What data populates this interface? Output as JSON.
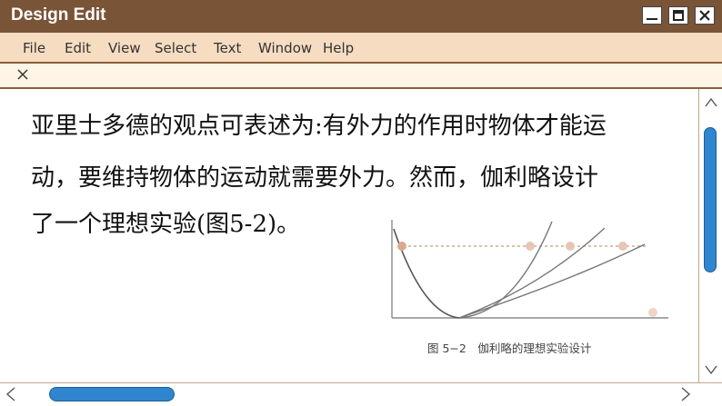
{
  "window": {
    "title": "Design Edit",
    "controls": [
      "minimize-icon",
      "maximize-icon",
      "close-icon"
    ]
  },
  "menu": {
    "items": [
      "File",
      "Edit",
      "View",
      "Select",
      "Text",
      "Window",
      "Help"
    ]
  },
  "tab": {
    "close_glyph": "×"
  },
  "document": {
    "lines": [
      "亚里士多德的观点可表述为:有外力的作用时物体才能运",
      "动，要维持物体的运动就需要外力。然而，伽利略设计",
      "了一个理想实验(图5-2)。"
    ],
    "figure_caption": "图 5−2　伽利略的理想实验设计"
  },
  "colors": {
    "titlebar": "#7a5437",
    "menubar": "#f6dcc0",
    "tabbar": "#fff5e6",
    "scroll_thumb": "#2f86cf",
    "ball": "#d9a88f"
  }
}
